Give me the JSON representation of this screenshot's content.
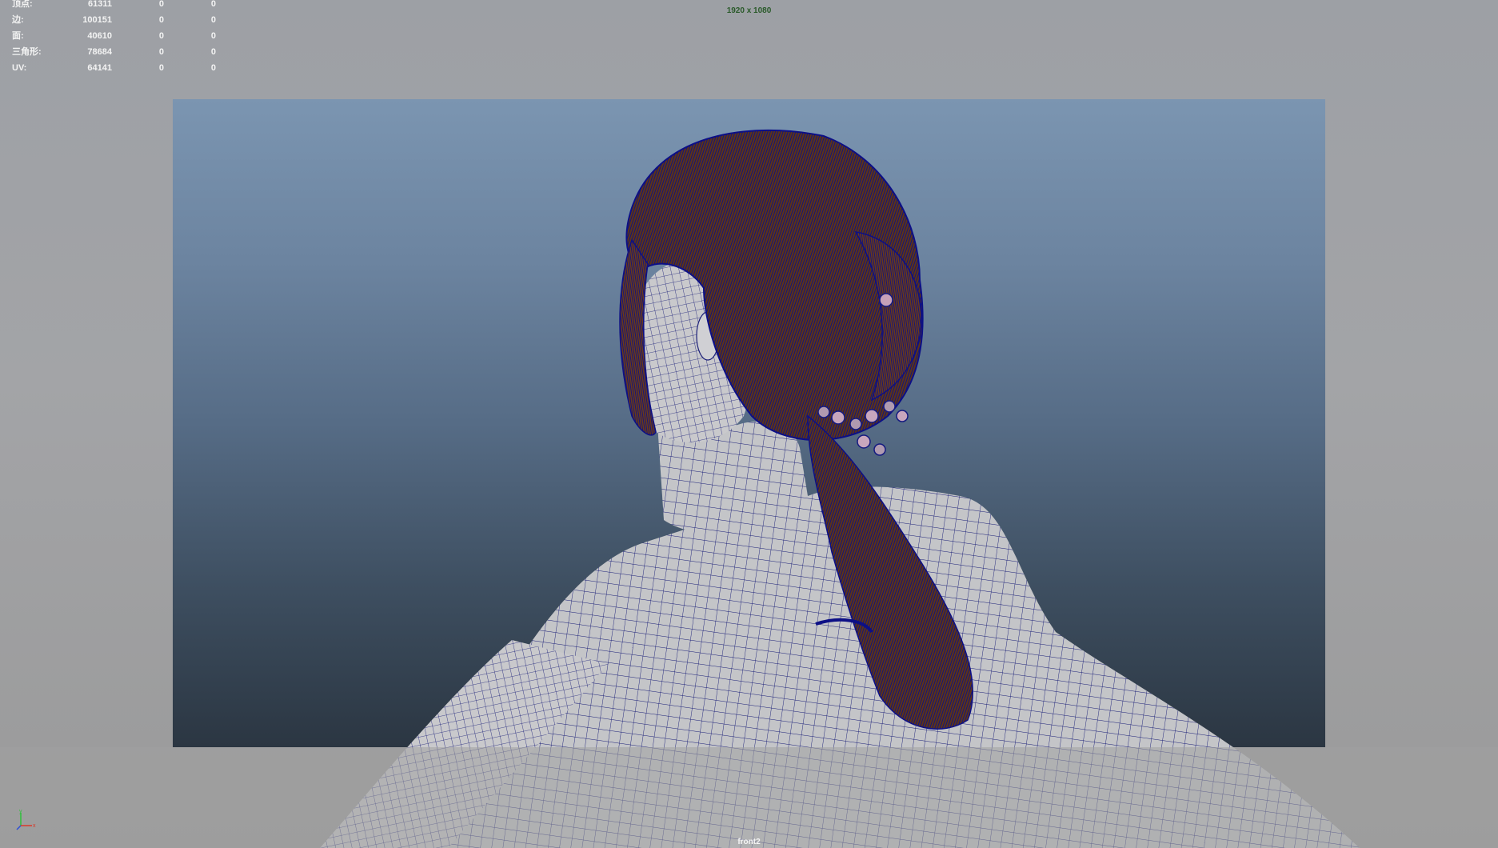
{
  "hud": {
    "rows": [
      {
        "label": "顶点:",
        "total": "61311",
        "selected": "0",
        "selected2": "0"
      },
      {
        "label": "边:",
        "total": "100151",
        "selected": "0",
        "selected2": "0"
      },
      {
        "label": "面:",
        "total": "40610",
        "selected": "0",
        "selected2": "0"
      },
      {
        "label": "三角形:",
        "total": "78684",
        "selected": "0",
        "selected2": "0"
      },
      {
        "label": "UV:",
        "total": "64141",
        "selected": "0",
        "selected2": "0"
      }
    ]
  },
  "viewport": {
    "resolution": "1920 x 1080",
    "camera": "front2",
    "colors": {
      "wireframe": "#141a80",
      "skin": "#c6c6c8",
      "hair": "#6b3a1c",
      "background_top": "#7b95b1",
      "background_bottom": "#2b3642"
    }
  },
  "axis_gizmo": {
    "icon": "axis-gizmo-icon",
    "x_label": "x",
    "y_label": "y"
  }
}
